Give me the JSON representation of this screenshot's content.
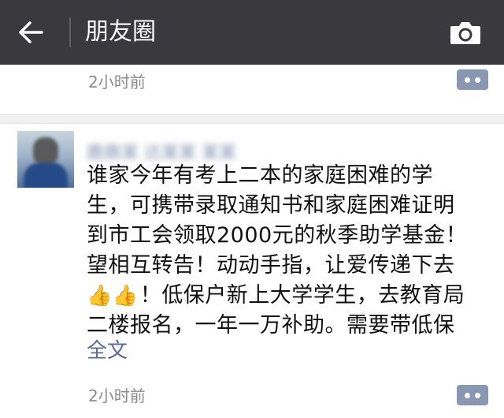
{
  "header": {
    "title": "朋友圈",
    "back_icon": "arrow-left-icon",
    "camera_icon": "camera-icon",
    "background_color": "#3a3a3e"
  },
  "prev_post": {
    "time": "2小时前",
    "more_icon": "more-dots-icon"
  },
  "post": {
    "author": "鹿鼎某 达某某 某某",
    "content_lines": [
      "谁家今年有考上二本的家庭困难的学",
      "生，可携带录取通知书和家庭困难证明",
      "到市工会领取2000元的秋季助学基金！",
      "望相互转告！动动手指，让爱传递下去"
    ],
    "line5_emoji": "👍👍",
    "line5_text": "！低保户新上大学学生，去教育局",
    "line6": "二楼报名，一年一万补助。需要带低保",
    "full_text_label": "全文",
    "time": "2小时前",
    "more_icon": "more-dots-icon",
    "link_color": "#576b95"
  }
}
